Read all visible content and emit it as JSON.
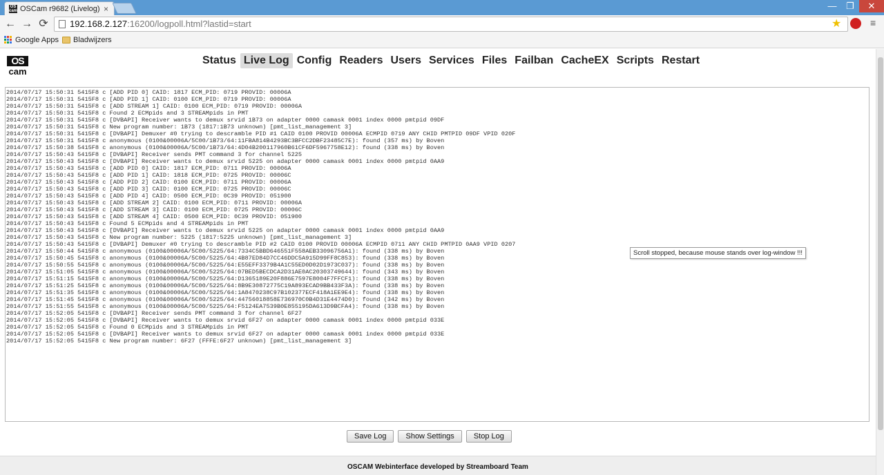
{
  "browser": {
    "tab_title": "OSCam r9682 (Livelog)",
    "tab_close": "×",
    "window_buttons": {
      "minimize": "—",
      "maximize": "❐",
      "close": "✕"
    },
    "address": {
      "host": "192.168.2.127",
      "rest": ":16200/logpoll.html?lastid=start"
    },
    "nav": {
      "back": "←",
      "forward": "→",
      "reload": "⟳"
    },
    "star": "★",
    "menu": "≡",
    "bookmarks": [
      {
        "label": "Google Apps",
        "icon": "apps-grid-icon"
      },
      {
        "label": "Bladwijzers",
        "icon": "folder-icon"
      }
    ]
  },
  "logo": {
    "top": "OS",
    "bottom": "cam"
  },
  "nav_items": [
    "Status",
    "Live Log",
    "Config",
    "Readers",
    "Users",
    "Services",
    "Files",
    "Failban",
    "CacheEX",
    "Scripts",
    "Restart"
  ],
  "active_nav": "Live Log",
  "log_lines": [
    "2014/07/17 15:50:31 5415F8 c [ADD PID 0] CAID: 1817 ECM_PID: 0719 PROVID: 00006A",
    "2014/07/17 15:50:31 5415F8 c [ADD PID 1] CAID: 0100 ECM_PID: 0719 PROVID: 00006A",
    "2014/07/17 15:50:31 5415F8 c [ADD STREAM 1] CAID: 0100 ECM_PID: 0719 PROVID: 00006A",
    "2014/07/17 15:50:31 5415F8 c Found 2 ECMpids and 3 STREAMpids in PMT",
    "2014/07/17 15:50:31 5415F8 c [DVBAPI] Receiver wants to demux srvid 1B73 on adapter 0000 camask 0001 index 0000 pmtpid 09DF",
    "2014/07/17 15:50:31 5415F8 c New program number: 1B73 (1817:1B73 unknown) [pmt_list_management 3]",
    "2014/07/17 15:50:31 5415F8 c [DVBAPI] Demuxer #0 trying to descramble PID #1 CAID 0100 PROVID 00006A ECMPID 0719 ANY CHID PMTPID 09DF VPID 020F",
    "2014/07/17 15:50:31 5415F8 c anonymous (0100&00006A/5C00/1B73/64:11FBA814B4293BC3BFCC2DBF23485C7E): found (357 ms) by Boven",
    "2014/07/17 15:50:38 5415F8 c anonymous (0100&00006A/5C00/1B73/64:4D04B200117960B61CF6DF5967758E12): found (338 ms) by Boven",
    "2014/07/17 15:50:43 5415F8 c [DVBAPI] Receiver sends PMT command 3 for channel 5225",
    "2014/07/17 15:50:43 5415F8 c [DVBAPI] Receiver wants to demux srvid 5225 on adapter 0000 camask 0001 index 0000 pmtpid 0AA9",
    "2014/07/17 15:50:43 5415F8 c [ADD PID 0] CAID: 1817 ECM_PID: 0711 PROVID: 00006A",
    "2014/07/17 15:50:43 5415F8 c [ADD PID 1] CAID: 1818 ECM_PID: 0725 PROVID: 00006C",
    "2014/07/17 15:50:43 5415F8 c [ADD PID 2] CAID: 0100 ECM_PID: 0711 PROVID: 00006A",
    "2014/07/17 15:50:43 5415F8 c [ADD PID 3] CAID: 0100 ECM_PID: 0725 PROVID: 00006C",
    "2014/07/17 15:50:43 5415F8 c [ADD PID 4] CAID: 0500 ECM_PID: 0C39 PROVID: 051900",
    "2014/07/17 15:50:43 5415F8 c [ADD STREAM 2] CAID: 0100 ECM_PID: 0711 PROVID: 00006A",
    "2014/07/17 15:50:43 5415F8 c [ADD STREAM 3] CAID: 0100 ECM_PID: 0725 PROVID: 00006C",
    "2014/07/17 15:50:43 5415F8 c [ADD STREAM 4] CAID: 0500 ECM_PID: 0C39 PROVID: 051900",
    "2014/07/17 15:50:43 5415F8 c Found 5 ECMpids and 4 STREAMpids in PMT",
    "2014/07/17 15:50:43 5415F8 c [DVBAPI] Receiver wants to demux srvid 5225 on adapter 0000 camask 0001 index 0000 pmtpid 0AA9",
    "2014/07/17 15:50:43 5415F8 c New program number: 5225 (1817:5225 unknown) [pmt_list_management 3]",
    "2014/07/17 15:50:43 5415F8 c [DVBAPI] Demuxer #0 trying to descramble PID #2 CAID 0100 PROVID 00006A ECMPID 0711 ANY CHID PMTPID 0AA9 VPID 0207",
    "2014/07/17 15:50:44 5415F8 c anonymous (0100&00006A/5C00/5225/64:7334C5BBD646551F558AEB33096756A1): found (338 ms) by Boven",
    "2014/07/17 15:50:45 5415F8 c anonymous (0100&00006A/5C00/5225/64:4B87ED84D7CC46DDC5A915D99FF8C853): found (338 ms) by Boven",
    "2014/07/17 15:50:55 5415F8 c anonymous (0100&00006A/5C00/5225/64:E55EFF3379B4A1C55ED0D02D1973C037): found (338 ms) by Boven",
    "2014/07/17 15:51:05 5415F8 c anonymous (0100&00006A/5C00/5225/64:07BED5BECDCA2D31AE0AC20303749644): found (343 ms) by Boven",
    "2014/07/17 15:51:15 5415F8 c anonymous (0100&00006A/5C00/5225/64:D1365189E20F886E7597E8004F7FFCF1): found (338 ms) by Boven",
    "2014/07/17 15:51:25 5415F8 c anonymous (0100&00006A/5C00/5225/64:8B9E30872775C19A893ECAD9BB433F3A): found (338 ms) by Boven",
    "2014/07/17 15:51:35 5415F8 c anonymous (0100&00006A/5C00/5225/64:1A8470238C97B102377ECF418A1EE9E4): found (338 ms) by Boven",
    "2014/07/17 15:51:45 5415F8 c anonymous (0100&00006A/5C00/5225/64:44756018858E736970C0B4D31E4474D0): found (342 ms) by Boven",
    "2014/07/17 15:51:55 5415F8 c anonymous (0100&00006A/5C00/5225/64:F5124EA7539B0E855195DA613D9BCFA4): found (338 ms) by Boven",
    "2014/07/17 15:52:05 5415F8 c [DVBAPI] Receiver sends PMT command 3 for channel 6F27",
    "2014/07/17 15:52:05 5415F8 c [DVBAPI] Receiver wants to demux srvid 6F27 on adapter 0000 camask 0001 index 0000 pmtpid 033E",
    "2014/07/17 15:52:05 5415F8 c Found 0 ECMpids and 3 STREAMpids in PMT",
    "2014/07/17 15:52:05 5415F8 c [DVBAPI] Receiver wants to demux srvid 6F27 on adapter 0000 camask 0001 index 0000 pmtpid 033E",
    "2014/07/17 15:52:05 5415F8 c New program number: 6F27 (FFFE:6F27 unknown) [pmt_list_management 3]"
  ],
  "tooltip": "Scroll stopped, because mouse stands over log-window !!!",
  "buttons": {
    "save": "Save Log",
    "settings": "Show Settings",
    "stop": "Stop Log"
  },
  "footer": "OSCAM Webinterface developed by Streamboard Team"
}
